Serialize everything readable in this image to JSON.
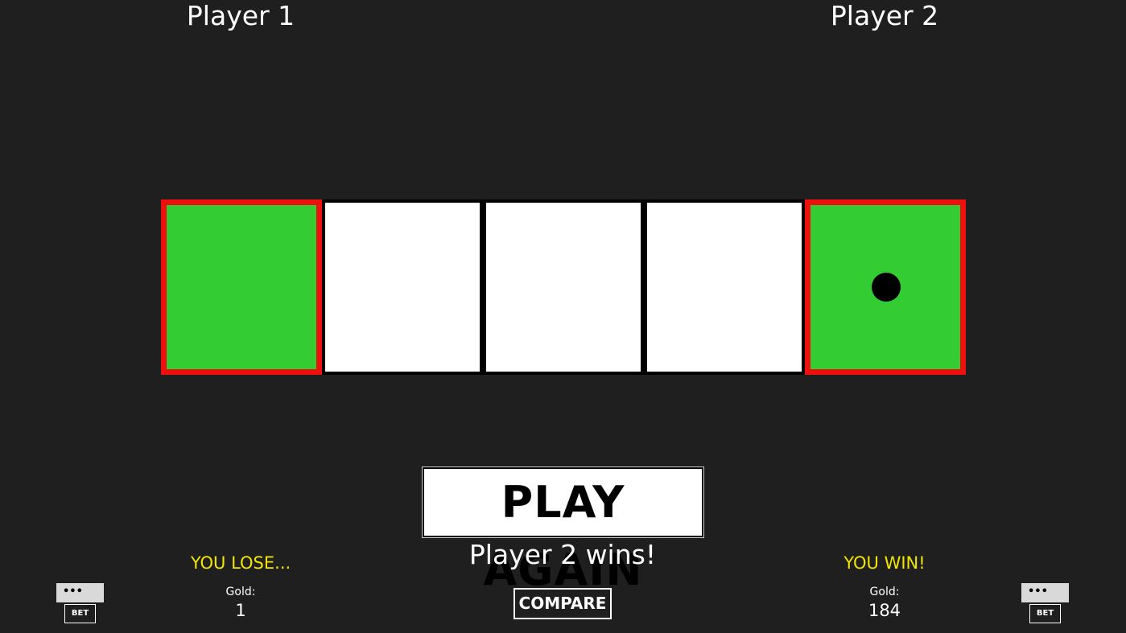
{
  "players": [
    {
      "title": "Player 1",
      "result": "YOU LOSE...",
      "gold_label": "Gold:",
      "gold_value": "1",
      "more_label": "•••",
      "bet_label": "BET"
    },
    {
      "title": "Player 2",
      "result": "YOU WIN!",
      "gold_label": "Gold:",
      "gold_value": "184",
      "more_label": "•••",
      "bet_label": "BET"
    }
  ],
  "board": {
    "cells": [
      {
        "color": "#33cc33",
        "highlight": "#ee0f0f",
        "has_token": false
      },
      {
        "color": "#ffffff",
        "highlight": null,
        "has_token": false
      },
      {
        "color": "#ffffff",
        "highlight": null,
        "has_token": false
      },
      {
        "color": "#ffffff",
        "highlight": null,
        "has_token": false
      },
      {
        "color": "#33cc33",
        "highlight": "#ee0f0f",
        "has_token": true
      }
    ]
  },
  "controls": {
    "play_again_label": "PLAY AGAIN",
    "winner_message": "Player 2 wins!",
    "compare_label": "COMPARE"
  },
  "colors": {
    "background": "#1f1f1f",
    "result_text": "#f2e600",
    "goal_cell": "#33cc33",
    "goal_border": "#ee0f0f"
  }
}
